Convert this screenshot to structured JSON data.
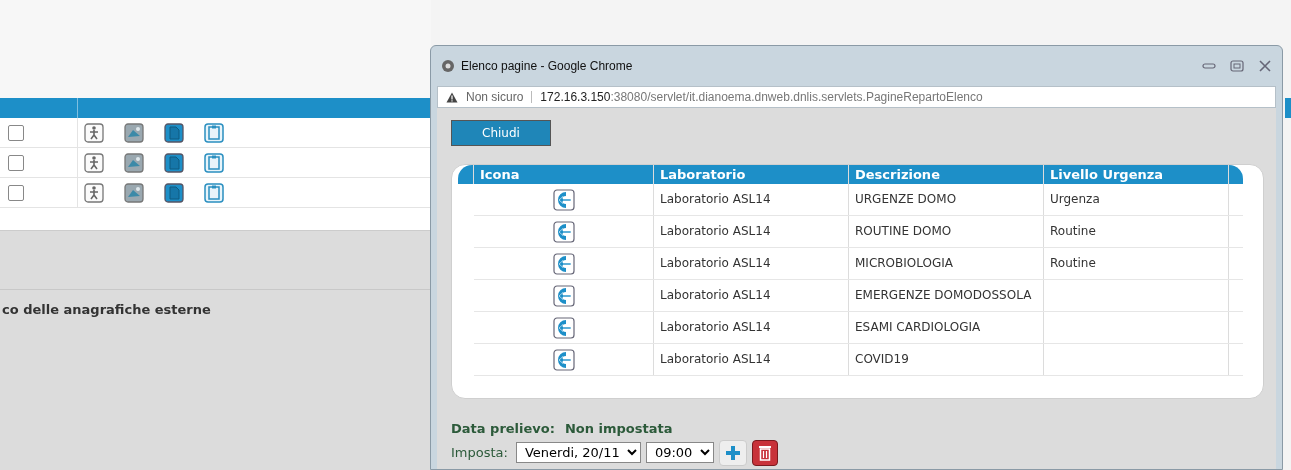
{
  "background_page": {
    "rows": [
      {
        "checked": false
      },
      {
        "checked": false
      },
      {
        "checked": false
      }
    ],
    "caption": "co delle anagrafiche esterne"
  },
  "window": {
    "title": "Elenco pagine - Google Chrome",
    "address": {
      "security": "Non sicuro",
      "host": "172.16.3.150",
      "path": ":38080/servlet/it.dianoema.dnweb.dnlis.servlets.PagineRepartoElenco"
    },
    "close_button": "Chiudi",
    "table": {
      "columns": [
        "Icona",
        "Laboratorio",
        "Descrizione",
        "Livello Urgenza"
      ],
      "rows": [
        {
          "laboratorio": "Laboratorio ASL14",
          "descrizione": "URGENZE DOMO",
          "livello": "Urgenza"
        },
        {
          "laboratorio": "Laboratorio ASL14",
          "descrizione": "ROUTINE DOMO",
          "livello": "Routine"
        },
        {
          "laboratorio": "Laboratorio ASL14",
          "descrizione": "MICROBIOLOGIA",
          "livello": "Routine"
        },
        {
          "laboratorio": "Laboratorio ASL14",
          "descrizione": "EMERGENZE DOMODOSSOLA"
        },
        {
          "laboratorio": "Laboratorio ASL14",
          "descrizione": "ESAMI CARDIOLOGIA"
        },
        {
          "laboratorio": "Laboratorio ASL14",
          "descrizione": "COVID19"
        }
      ]
    },
    "sampling": {
      "label": "Data prelievo:",
      "value": "Non impostata",
      "set_label": "Imposta:",
      "day": "Venerdi, 20/11",
      "time": "09:00"
    }
  }
}
